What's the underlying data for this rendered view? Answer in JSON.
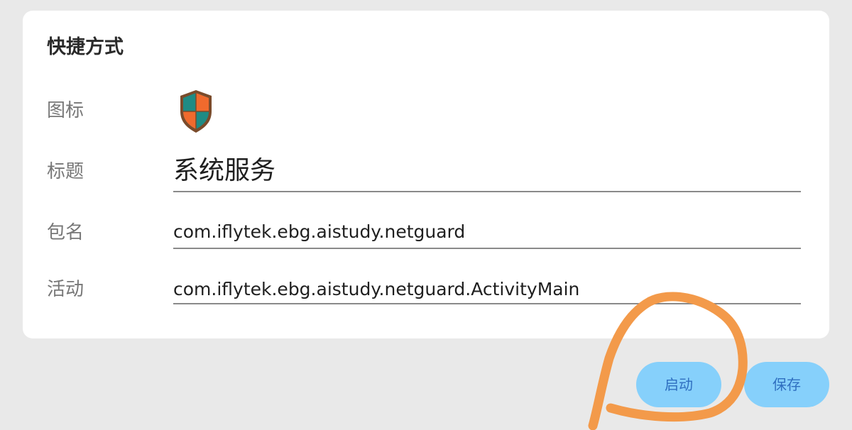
{
  "card": {
    "title": "快捷方式",
    "icon_label": "图标",
    "icon_name": "shield-icon",
    "title_label": "标题",
    "title_value": "系统服务",
    "package_label": "包名",
    "package_value": "com.iflytek.ebg.aistudy.netguard",
    "activity_label": "活动",
    "activity_value": "com.iflytek.ebg.aistudy.netguard.ActivityMain"
  },
  "buttons": {
    "launch": "启动",
    "save": "保存"
  },
  "colors": {
    "background": "#e9e9e9",
    "card": "#ffffff",
    "button_bg": "#86d0fb",
    "button_text": "#2f6fc0",
    "annotation": "#f39a4a",
    "shield_teal": "#1f8b84",
    "shield_orange": "#f06a2d"
  }
}
